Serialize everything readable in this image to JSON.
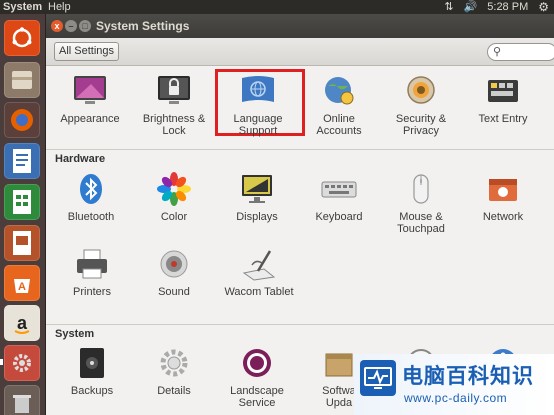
{
  "top_panel": {
    "app_name": "System",
    "menu": "Help",
    "time": "5:28 PM"
  },
  "window": {
    "title": "System Settings",
    "close_glyph": "x",
    "min_glyph": "–",
    "max_glyph": "□"
  },
  "toolbar": {
    "all_settings": "All Settings",
    "search_placeholder": ""
  },
  "sections": {
    "personal": {
      "items": [
        {
          "label": "Appearance",
          "icon": "appearance-icon"
        },
        {
          "label": "Brightness &\nLock",
          "icon": "brightness-lock-icon"
        },
        {
          "label": "Language\nSupport",
          "icon": "language-support-icon",
          "highlighted": true
        },
        {
          "label": "Online\nAccounts",
          "icon": "online-accounts-icon"
        },
        {
          "label": "Security &\nPrivacy",
          "icon": "security-privacy-icon"
        },
        {
          "label": "Text Entry",
          "icon": "text-entry-icon"
        }
      ]
    },
    "hardware": {
      "title": "Hardware",
      "items": [
        {
          "label": "Bluetooth",
          "icon": "bluetooth-icon"
        },
        {
          "label": "Color",
          "icon": "color-icon"
        },
        {
          "label": "Displays",
          "icon": "displays-icon"
        },
        {
          "label": "Keyboard",
          "icon": "keyboard-icon"
        },
        {
          "label": "Mouse &\nTouchpad",
          "icon": "mouse-icon"
        },
        {
          "label": "Network",
          "icon": "network-icon"
        },
        {
          "label": "Printers",
          "icon": "printer-icon"
        },
        {
          "label": "Sound",
          "icon": "sound-icon"
        },
        {
          "label": "Wacom Tablet",
          "icon": "wacom-tablet-icon"
        }
      ]
    },
    "system": {
      "title": "System",
      "items": [
        {
          "label": "Backups",
          "icon": "backups-icon"
        },
        {
          "label": "Details",
          "icon": "details-icon"
        },
        {
          "label": "Landscape\nService",
          "icon": "landscape-icon"
        },
        {
          "label": "Softwa\nUpda",
          "icon": "software-updates-icon"
        },
        {
          "label": "",
          "icon": "time-date-icon"
        },
        {
          "label": "",
          "icon": "universal-access-icon"
        }
      ]
    }
  },
  "watermark": {
    "brand": "电脑百科知识",
    "url": "www.pc-daily.com"
  },
  "colors": {
    "highlight": "#e02020",
    "ubuntu_orange": "#dd4814"
  }
}
